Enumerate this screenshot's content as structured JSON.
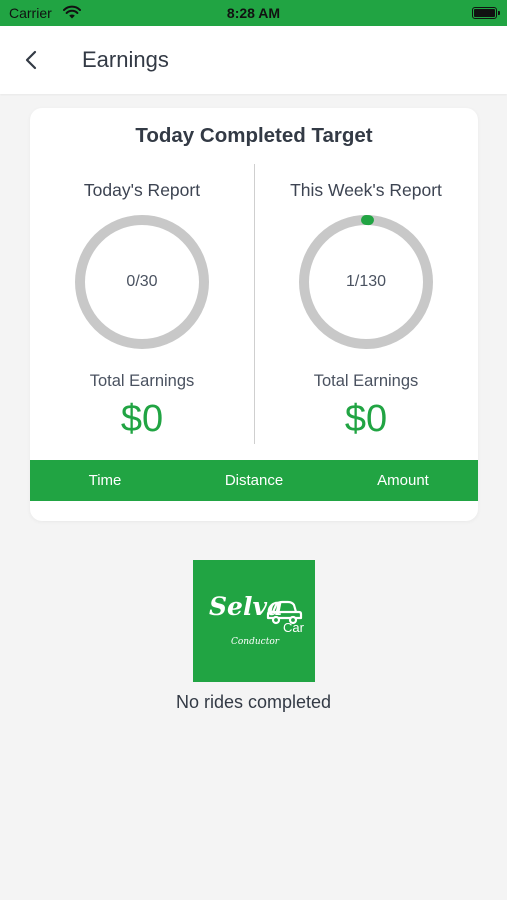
{
  "status_bar": {
    "carrier": "Carrier",
    "time": "8:28 AM",
    "background": "#21a443"
  },
  "nav": {
    "back_icon": "chevron-left-icon",
    "title": "Earnings"
  },
  "target_card": {
    "title": "Today Completed Target",
    "today": {
      "label": "Today's Report",
      "progress_text": "0/30",
      "completed": 0,
      "target": 30,
      "earnings_label": "Total Earnings",
      "earnings_value": "$0"
    },
    "week": {
      "label": "This Week's Report",
      "progress_text": "1/130",
      "completed": 1,
      "target": 130,
      "earnings_label": "Total Earnings",
      "earnings_value": "$0"
    },
    "table_headers": [
      "Time",
      "Distance",
      "Amount"
    ]
  },
  "logo": {
    "word": "Selva",
    "sub": "Car",
    "tag": "Conductor"
  },
  "empty_state": {
    "message": "No rides completed"
  },
  "colors": {
    "accent": "#21a443",
    "ring_track": "#c8c8c8",
    "text": "#333a45"
  }
}
